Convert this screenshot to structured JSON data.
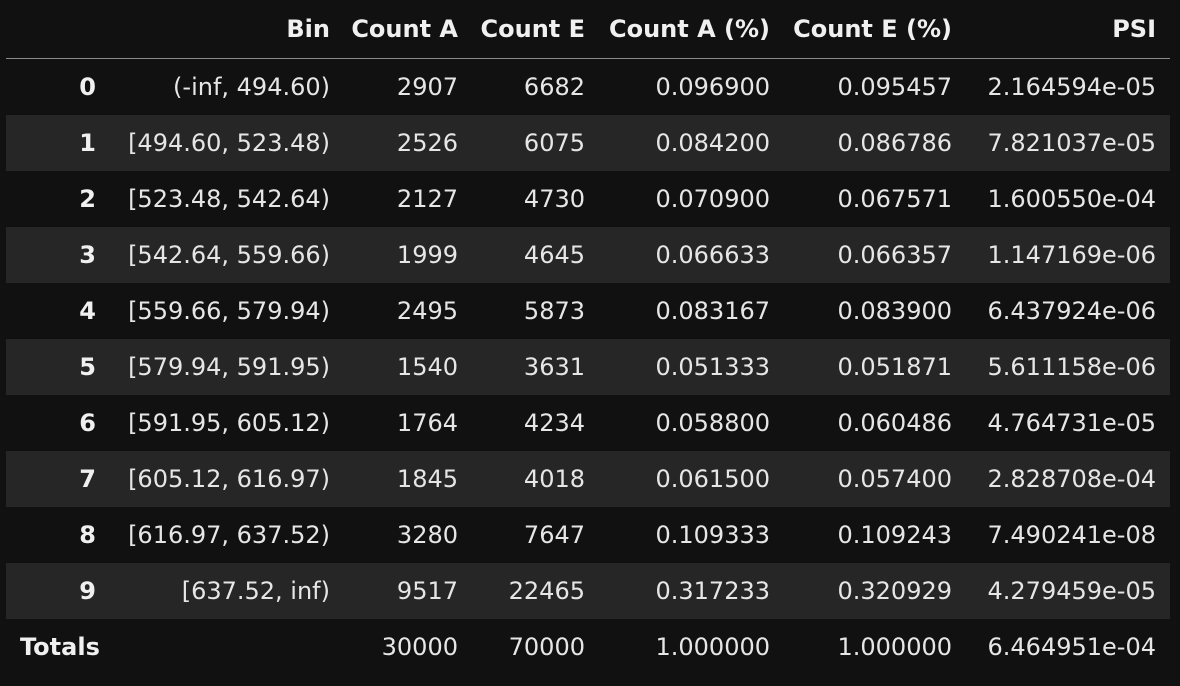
{
  "table": {
    "columns": [
      "",
      "Bin",
      "Count A",
      "Count E",
      "Count A (%)",
      "Count E (%)",
      "PSI"
    ],
    "rows": [
      {
        "index": "0",
        "bin": "(-inf, 494.60)",
        "count_a": "2907",
        "count_e": "6682",
        "pct_a": "0.096900",
        "pct_e": "0.095457",
        "psi": "2.164594e-05"
      },
      {
        "index": "1",
        "bin": "[494.60, 523.48)",
        "count_a": "2526",
        "count_e": "6075",
        "pct_a": "0.084200",
        "pct_e": "0.086786",
        "psi": "7.821037e-05"
      },
      {
        "index": "2",
        "bin": "[523.48, 542.64)",
        "count_a": "2127",
        "count_e": "4730",
        "pct_a": "0.070900",
        "pct_e": "0.067571",
        "psi": "1.600550e-04"
      },
      {
        "index": "3",
        "bin": "[542.64, 559.66)",
        "count_a": "1999",
        "count_e": "4645",
        "pct_a": "0.066633",
        "pct_e": "0.066357",
        "psi": "1.147169e-06"
      },
      {
        "index": "4",
        "bin": "[559.66, 579.94)",
        "count_a": "2495",
        "count_e": "5873",
        "pct_a": "0.083167",
        "pct_e": "0.083900",
        "psi": "6.437924e-06"
      },
      {
        "index": "5",
        "bin": "[579.94, 591.95)",
        "count_a": "1540",
        "count_e": "3631",
        "pct_a": "0.051333",
        "pct_e": "0.051871",
        "psi": "5.611158e-06"
      },
      {
        "index": "6",
        "bin": "[591.95, 605.12)",
        "count_a": "1764",
        "count_e": "4234",
        "pct_a": "0.058800",
        "pct_e": "0.060486",
        "psi": "4.764731e-05"
      },
      {
        "index": "7",
        "bin": "[605.12, 616.97)",
        "count_a": "1845",
        "count_e": "4018",
        "pct_a": "0.061500",
        "pct_e": "0.057400",
        "psi": "2.828708e-04"
      },
      {
        "index": "8",
        "bin": "[616.97, 637.52)",
        "count_a": "3280",
        "count_e": "7647",
        "pct_a": "0.109333",
        "pct_e": "0.109243",
        "psi": "7.490241e-08"
      },
      {
        "index": "9",
        "bin": "[637.52, inf)",
        "count_a": "9517",
        "count_e": "22465",
        "pct_a": "0.317233",
        "pct_e": "0.320929",
        "psi": "4.279459e-05"
      }
    ],
    "totals": {
      "index": "Totals",
      "bin": "",
      "count_a": "30000",
      "count_e": "70000",
      "pct_a": "1.000000",
      "pct_e": "1.000000",
      "psi": "6.464951e-04"
    }
  },
  "colors": {
    "background": "#111111",
    "stripe": "#262626",
    "text": "#e6e6e6",
    "header_rule": "#8a8a8a"
  }
}
